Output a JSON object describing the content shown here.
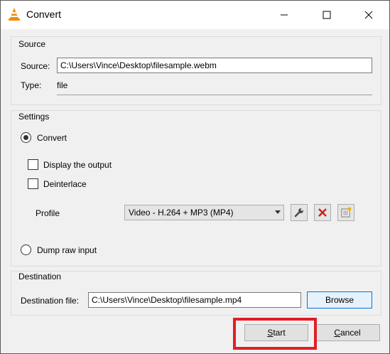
{
  "window": {
    "title": "Convert"
  },
  "source": {
    "group_title": "Source",
    "source_label": "Source:",
    "source_value": "C:\\Users\\Vince\\Desktop\\filesample.webm",
    "type_label": "Type:",
    "type_value": "file"
  },
  "settings": {
    "group_title": "Settings",
    "convert_label": "Convert",
    "display_output_label": "Display the output",
    "deinterlace_label": "Deinterlace",
    "profile_label": "Profile",
    "profile_selected": "Video - H.264 + MP3 (MP4)",
    "dump_raw_label": "Dump raw input"
  },
  "destination": {
    "group_title": "Destination",
    "file_label": "Destination file:",
    "file_value": "C:\\Users\\Vince\\Desktop\\filesample.mp4",
    "browse_label": "Browse"
  },
  "buttons": {
    "start_label": "Start",
    "cancel_label": "Cancel"
  },
  "colors": {
    "highlight": "#e01e26",
    "accent": "#0078d7",
    "delete_icon": "#d21f1f"
  },
  "icons": [
    "vlc-cone-icon",
    "minimize-icon",
    "maximize-icon",
    "close-icon",
    "wrench-icon",
    "delete-icon",
    "new-profile-icon",
    "dropdown-arrow-icon"
  ]
}
